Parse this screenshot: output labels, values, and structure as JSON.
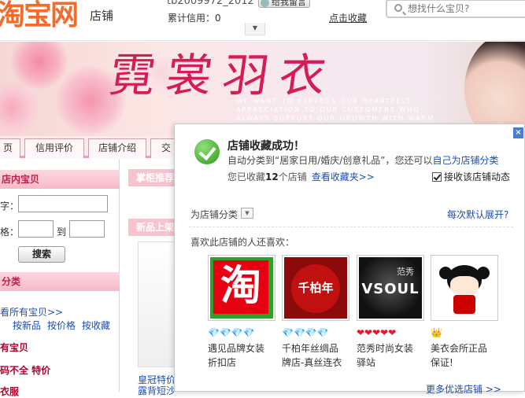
{
  "header": {
    "logo_text": "淘宝网",
    "logo_sub": "店铺",
    "seller_id": "tb2009972_2012",
    "msg_button": "给我留言",
    "credit_label": "累计信用：0",
    "fav_link": "点击收藏",
    "dropdown_icon": "▼",
    "search_placeholder": "想找什么宝贝?"
  },
  "banner": {
    "title": "霓裳羽衣",
    "english": "WE WANT TO EXPRESS OUR HEARTFELT APPRECIATION TO OUR CUSTOMERS WHO ALWAYS SUPPORT OUR GROWTH WITH WARM CARE AND WE PLEDGE TO DO OUR BEST"
  },
  "nav": {
    "tabs": [
      "页",
      "信用评价",
      "店铺介绍",
      "交"
    ]
  },
  "left": {
    "search_head": "店内宝贝",
    "keyword_label": "字：",
    "price_label": "格：",
    "to_label": "到",
    "search_button": "搜索",
    "cat_head": "分类",
    "all_items_link": "看所有宝贝>>",
    "sort_links": [
      "按新品",
      "按价格",
      "按收藏"
    ],
    "cat_items": [
      "有宝贝",
      "码不全 特价",
      "衣服"
    ]
  },
  "mid": {
    "head1": "掌柜推荐",
    "head2": "新品上架",
    "crown_text": "皇冠特价 露背短沙"
  },
  "popup": {
    "close_icon": "×",
    "title": "店铺收藏成功！",
    "line1_pre": "自动分类到“居家日用/婚庆/创意礼品”，您还可以",
    "line1_link": "自己为店铺分类",
    "line2_pre": "您已收藏",
    "line2_count": "12",
    "line2_post": "个店铺",
    "view_link": "查看收藏夹>>",
    "checkbox_label": "接收该店铺动态",
    "cat_label": "为店铺分类",
    "cat_dropdown": "▼",
    "expand_link": "每次默认展开?",
    "also_label": "喜欢此店铺的人还喜欢：",
    "shops": [
      {
        "name_line1": "遇见品牌女装",
        "name_line2": "折扣店",
        "rating": "💎💎💎💎",
        "rating_color": "#2aa8d8",
        "logo_text": "淘",
        "logo_bg": "#e60012",
        "logo_fg": "#2fa12a"
      },
      {
        "name_line1": "千柏年丝绸品",
        "name_line2": "牌店-真丝连衣",
        "rating": "💎💎💎💎",
        "rating_color": "#2aa8d8",
        "logo_text": "千柏年",
        "logo_bg": "#8b0a0a",
        "logo_fg": "#ffffff"
      },
      {
        "name_line1": "范秀时尚女装",
        "name_line2": "驿站",
        "rating": "❤❤❤❤❤",
        "rating_color": "#e8172d",
        "logo_text": "VSOUL",
        "logo_sub": "范秀",
        "logo_bg": "#111111",
        "logo_fg": "#ffffff"
      },
      {
        "name_line1": "美衣会所正品",
        "name_line2": "保证!",
        "rating": "👑",
        "rating_color": "#2aa8d8",
        "logo_text": "",
        "logo_bg": "#ffffff",
        "logo_fg": "#cc0000"
      }
    ],
    "more_link": "更多优选店铺 >>"
  }
}
